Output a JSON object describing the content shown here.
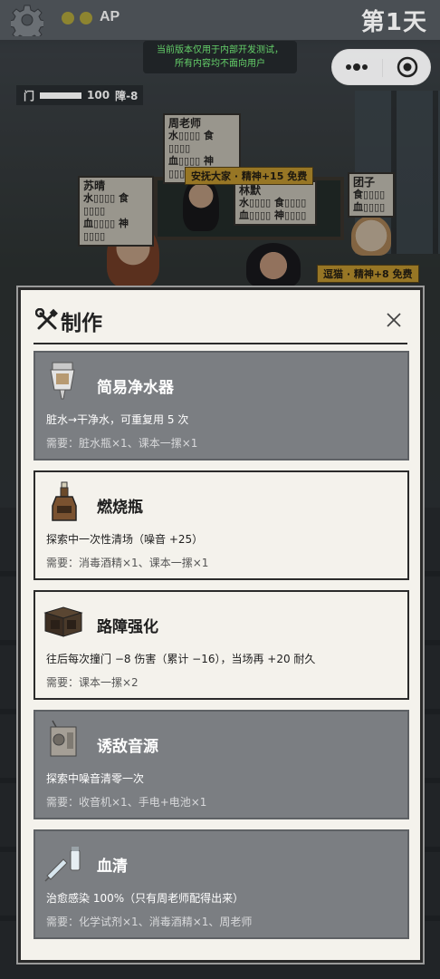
{
  "hud": {
    "ap_label": "AP",
    "day_label": "第1天",
    "dev_notice_line1": "当前版本仅用于内部开发测试，",
    "dev_notice_line2": "所有内容均不面向用户",
    "door_label": "门",
    "door_value": "100",
    "door_damage": "障-8",
    "door_level": 1.0
  },
  "characters": [
    {
      "name": "周老师",
      "line1": "水▯▯▯▯ 食▯▯▯▯",
      "line2": "血▯▯▯▯ 神▯▯▯▯"
    },
    {
      "name": "苏晴",
      "line1": "水▯▯▯▯ 食▯▯▯▯",
      "line2": "血▯▯▯▯ 神▯▯▯▯"
    },
    {
      "name": "林默",
      "line1": "水▯▯▯▯ 食▯▯▯▯",
      "line2": "血▯▯▯▯ 神▯▯▯▯"
    },
    {
      "name": "团子",
      "line1": "食▯▯▯▯",
      "line2": "血▯▯▯▯"
    }
  ],
  "events": {
    "comfort": "安抚大家 · 精神+15 免费",
    "pet_cat": "逗猫 · 精神+8 免费"
  },
  "modal": {
    "title": "制作",
    "recipes": [
      {
        "name": "简易净水器",
        "desc": "脏水→干净水，可重复用 5 次",
        "req": "需要：脏水瓶×1、课本一摞×1",
        "available": false,
        "icon": "water-filter-icon"
      },
      {
        "name": "燃烧瓶",
        "desc": "探索中一次性清场（噪音 +25）",
        "req": "需要：消毒酒精×1、课本一摞×1",
        "available": true,
        "icon": "molotov-icon"
      },
      {
        "name": "路障强化",
        "desc": "往后每次撞门 −8 伤害（累计 −16），当场再 +20 耐久",
        "req": "需要：课本一摞×2",
        "available": true,
        "icon": "barricade-icon"
      },
      {
        "name": "诱敌音源",
        "desc": "探索中噪音清零一次",
        "req": "需要：收音机×1、手电+电池×1",
        "available": false,
        "icon": "radio-decoy-icon"
      },
      {
        "name": "血清",
        "desc": "治愈感染 100%（只有周老师配得出来）",
        "req": "需要：化学试剂×1、消毒酒精×1、周老师",
        "available": false,
        "icon": "serum-icon"
      }
    ]
  },
  "colors": {
    "panel_bg": "#f4f2ec",
    "recipe_locked_bg": "#7b7e82",
    "event_tag": "#e8b53a",
    "notice_text": "#65d16a"
  }
}
